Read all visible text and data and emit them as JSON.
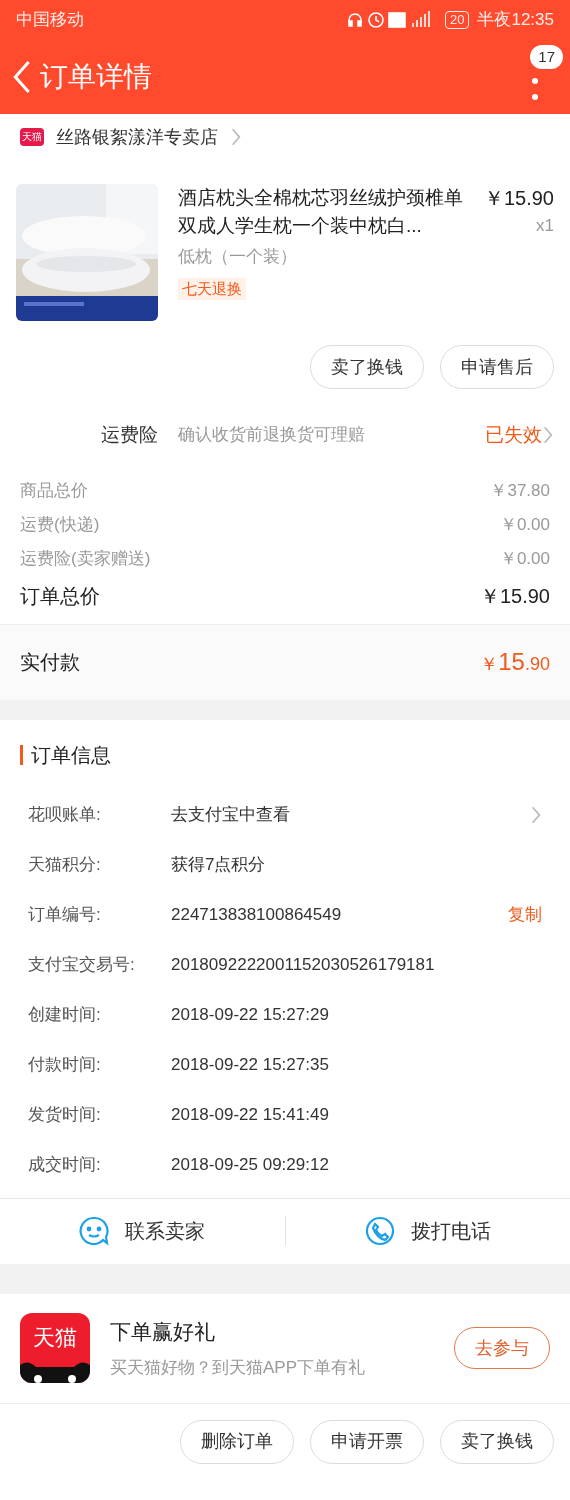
{
  "status_bar": {
    "carrier": "中国移动",
    "battery": "20",
    "time": "半夜12:35"
  },
  "header": {
    "title": "订单详情",
    "badge": "17"
  },
  "store": {
    "badge": "天猫",
    "name": "丝路银絮漾洋专卖店"
  },
  "product": {
    "title": "酒店枕头全棉枕芯羽丝绒护颈椎单双成人学生枕一个装中枕白...",
    "price": "￥15.90",
    "quantity": "x1",
    "variant": "低枕（一个装）",
    "tag": "七天退换",
    "actions": [
      "卖了换钱",
      "申请售后"
    ]
  },
  "insurance": {
    "label": "运费险",
    "description": "确认收货前退换货可理赔",
    "status": "已失效"
  },
  "price_rows": [
    {
      "label": "商品总价",
      "value": "￥37.80",
      "kind": "minor"
    },
    {
      "label": "运费(快递)",
      "value": "￥0.00",
      "kind": "minor"
    },
    {
      "label": "运费险(卖家赠送)",
      "value": "￥0.00",
      "kind": "minor"
    },
    {
      "label": "订单总价",
      "value": "￥15.90",
      "kind": "total"
    }
  ],
  "paid": {
    "label": "实付款",
    "currency": "￥",
    "integer": "15",
    "decimal": ".90"
  },
  "order_info": {
    "title": "订单信息",
    "rows": [
      {
        "label": "花呗账单:",
        "value": "去支付宝中查看",
        "kind": "link"
      },
      {
        "label": "天猫积分:",
        "value": "获得7点积分",
        "kind": "plain"
      },
      {
        "label": "订单编号:",
        "value": "224713838100864549",
        "kind": "copy",
        "action": "复制"
      },
      {
        "label": "支付宝交易号:",
        "value": "2018092222001152030526179181",
        "kind": "plain"
      },
      {
        "label": "创建时间:",
        "value": "2018-09-22 15:27:29",
        "kind": "plain"
      },
      {
        "label": "付款时间:",
        "value": "2018-09-22 15:27:35",
        "kind": "plain"
      },
      {
        "label": "发货时间:",
        "value": "2018-09-22 15:41:49",
        "kind": "plain"
      },
      {
        "label": "成交时间:",
        "value": "2018-09-25 09:29:12",
        "kind": "plain"
      }
    ]
  },
  "contact": [
    {
      "label": "联系卖家",
      "kind": "chat"
    },
    {
      "label": "拨打电话",
      "kind": "phone"
    }
  ],
  "promo": {
    "logo": "天猫",
    "title": "下单赢好礼",
    "subtitle": "买天猫好物？到天猫APP下单有礼",
    "button": "去参与"
  },
  "bottom_actions": [
    "删除订单",
    "申请开票",
    "卖了换钱"
  ]
}
